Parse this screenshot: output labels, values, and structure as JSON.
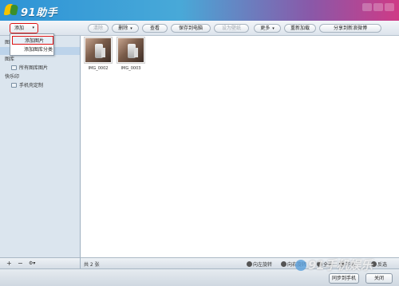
{
  "app": {
    "title": "91助手"
  },
  "toolbar": {
    "add": "添加",
    "delete": "删除",
    "view": "查看",
    "save_to_pc": "保存到电脑",
    "set_wallpaper": "设为壁纸",
    "more": "更多",
    "reload": "重新加载",
    "share": "分享到新浪微博"
  },
  "dropdown": {
    "items": [
      "添加图片",
      "添加图库分类"
    ]
  },
  "sidebar": {
    "items": [
      {
        "label": "图"
      },
      {
        "label": "图库"
      },
      {
        "label": "所有图库图片"
      },
      {
        "label": "快乐印"
      },
      {
        "label": "手机壳定制"
      }
    ],
    "bottom": {
      "add": "+",
      "remove": "−",
      "settings": "⚙▾"
    }
  },
  "photos": [
    {
      "label": "IMG_0002"
    },
    {
      "label": "IMG_0003"
    }
  ],
  "statusbar": {
    "count": "共 2 张",
    "rotate_left": "向左旋转",
    "rotate_right": "向右旋转",
    "select_all": "全选",
    "deselect": "不选",
    "invert": "反选"
  },
  "footer": {
    "sync": "同步到手机",
    "close": "关闭"
  },
  "watermark": "91手机娱乐"
}
